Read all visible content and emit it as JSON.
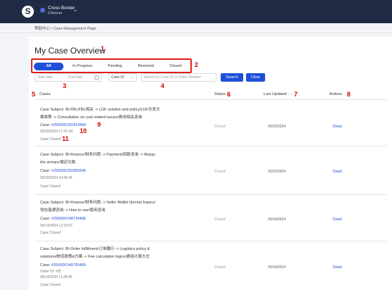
{
  "header": {
    "logo_char": "S",
    "brand_title": "Cross Border",
    "brand_subtitle": "Chinese",
    "chevron": "⌄"
  },
  "breadcrumb": "帮助中心 / Case Management Page",
  "page_title": "My Case Overview",
  "annotations": [
    "1",
    "2",
    "3",
    "4",
    "5",
    "6",
    "7",
    "8",
    "9",
    "10",
    "11"
  ],
  "tabs": [
    {
      "label": "All",
      "active": true
    },
    {
      "label": "In Progress",
      "active": false
    },
    {
      "label": "Pending",
      "active": false
    },
    {
      "label": "Resolved",
      "active": false
    },
    {
      "label": "Closed",
      "active": false
    }
  ],
  "filters": {
    "start_placeholder": "Start date",
    "end_placeholder": "End date",
    "calendar_icon": "calendar-icon",
    "case_id_select": "Case ID",
    "search_placeholder": "Search by Case ID or Order Number",
    "search_label": "Search",
    "clear_label": "Clear"
  },
  "columns": {
    "cases": "Cases",
    "status": "Status",
    "last_updated": "Last Updated",
    "sort_icon": "sort-icon",
    "actions": "Actions"
  },
  "rows": [
    {
      "subject_line1": "Case Subject: IB-FBL/FBL相关 -> LGF solution and policy/LGF仓发方",
      "subject_line2": "案政策 -> Consultation on cost related issues/费用相关咨询",
      "case_prefix": "Case: ",
      "case_id": "#2500001504239​84",
      "order_line": "",
      "created": "05/22/2024 17:47:43",
      "closed_text": "Case Closed",
      "status": "Closed",
      "updated": "05/22/2024",
      "action": "Detail"
    },
    {
      "subject_line1": "Case Subject: IB-Finance/财务问题 -> Payment/回款咨询 -> Repay",
      "subject_line2": "the arrears/偿还欠款",
      "case_prefix": "Case: ",
      "case_id": "#250000150380645",
      "order_line": "",
      "created": "05/22/2024 10:45:41",
      "closed_text": "Case Closed",
      "status": "Closed",
      "updated": "05/22/2024",
      "action": "Detail"
    },
    {
      "subject_line1": "Case Subject: IB-Finance/财务问题 -> Seller Wallet Normal Inquiry/",
      "subject_line2": "钱包普通咨询 -> How to use/使用咨询",
      "case_prefix": "Case: ",
      "case_id": "#250000149734486",
      "order_line": "",
      "created": "05/14/2024 12:10:07",
      "closed_text": "Case Closed",
      "status": "Closed",
      "updated": "05/14/2024",
      "action": "Detail"
    },
    {
      "subject_line1": "Case Subject: IB-Order fulfillment/订单履行 -> Logistics policy &",
      "subject_line2": "solutions/物流政策&方案 -> Fee calculation logics/费用计算方式",
      "case_prefix": "Case: ",
      "case_id": "#250000149730480",
      "order_line": "Order ID: #无",
      "created": "05/14/2024 11:28:46",
      "closed_text": "Case Closed",
      "status": "Closed",
      "updated": "05/14/2024",
      "action": "Detail"
    }
  ]
}
